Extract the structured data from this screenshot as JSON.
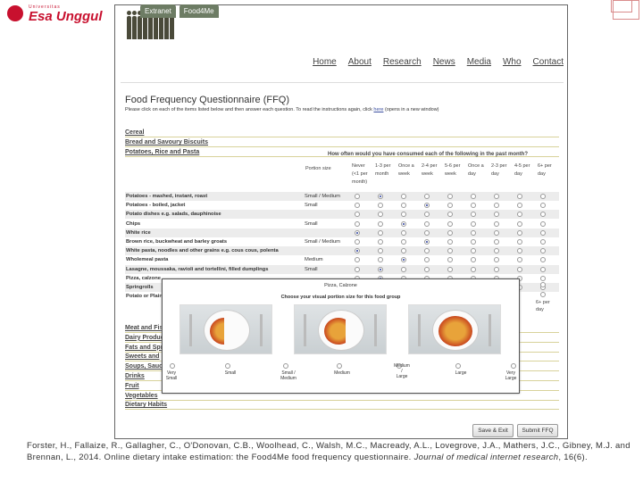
{
  "brand": {
    "small": "Universitas",
    "name": "Esa Unggul"
  },
  "top_links": [
    "Extranet",
    "Food4Me"
  ],
  "nav": [
    "Home",
    "About",
    "Research",
    "News",
    "Media",
    "Who",
    "Contact"
  ],
  "ffq": {
    "title": "Food Frequency Questionnaire (FFQ)",
    "instr_pre": "Please click on each of the items listed below and then answer each question. To read the instructions again, click ",
    "instr_link": "here",
    "instr_post": " (opens in a new window)"
  },
  "categories_top": [
    "Cereal",
    "Bread and Savoury Biscuits",
    "Potatoes, Rice and Pasta"
  ],
  "question": "How often would you have consumed each of the following in the past month?",
  "portion_header": "Portion size",
  "freq_headers": [
    [
      "Never",
      "(<1 per",
      "month)"
    ],
    [
      "1-3 per",
      "month"
    ],
    [
      "Once a",
      "week"
    ],
    [
      "2-4 per",
      "week"
    ],
    [
      "5-6 per",
      "week"
    ],
    [
      "Once a",
      "day"
    ],
    [
      "2-3 per",
      "day"
    ],
    [
      "4-5 per",
      "day"
    ],
    [
      "6+ per",
      "day"
    ]
  ],
  "foods": [
    {
      "name": "Potatoes - mashed, instant, roast",
      "portion": "Small / Medium",
      "sel": 1
    },
    {
      "name": "Potatoes - boiled, jacket",
      "portion": "Small",
      "sel": 3
    },
    {
      "name": "Potato dishes e.g. salads, dauphinoise",
      "portion": "",
      "sel": -1
    },
    {
      "name": "Chips",
      "portion": "Small",
      "sel": 2
    },
    {
      "name": "White rice",
      "portion": "",
      "sel": 0
    },
    {
      "name": "Brown rice, buckwheat and barley groats",
      "portion": "Small / Medium",
      "sel": 3
    },
    {
      "name": "White pasta, noodles and other grains e.g. cous cous, polenta",
      "portion": "",
      "sel": 0
    },
    {
      "name": "Wholemeal pasta",
      "portion": "Medium",
      "sel": 2
    },
    {
      "name": "Lasagne, moussaka, ravioli and tortellini, filled dumplings",
      "portion": "Small",
      "sel": 1
    },
    {
      "name": "Pizza, calzone",
      "portion": "",
      "sel": 1
    },
    {
      "name": "Springrolls",
      "portion": "",
      "sel": -1
    },
    {
      "name": "Potato or Plain",
      "portion": "",
      "sel": -1
    }
  ],
  "categories_bottom": [
    "Meat and Fis",
    "Dairy Produc",
    "Fats and Spr",
    "Sweets and",
    "Soups, Sauc",
    "Drinks",
    "Fruit",
    "Vegetables",
    "Dietary Habits"
  ],
  "right_cut_header": [
    "6+ per",
    "day"
  ],
  "popup": {
    "title": "Pizza, Calzone",
    "subtitle": "Choose your visual portion size for this food group",
    "options": [
      [
        "Very",
        "Small"
      ],
      [
        "Small"
      ],
      [
        "Small /",
        "Medium"
      ],
      [
        "Medium"
      ],
      [
        "Medium",
        "/",
        "Large"
      ],
      [
        "Large"
      ],
      [
        "Very",
        "Large"
      ]
    ]
  },
  "buttons": {
    "save": "Save & Exit",
    "submit": "Submit FFQ"
  },
  "citation": {
    "text": "Forster, H., Fallaize, R., Gallagher, C., O'Donovan, C.B., Woolhead, C., Walsh, M.C., Macready, A.L., Lovegrove, J.A., Mathers, J.C., Gibney, M.J. and Brennan, L., 2014. Online dietary intake estimation: the Food4Me food frequency questionnaire. ",
    "journal": "Journal of medical internet research",
    "rest": ", 16(6)."
  }
}
